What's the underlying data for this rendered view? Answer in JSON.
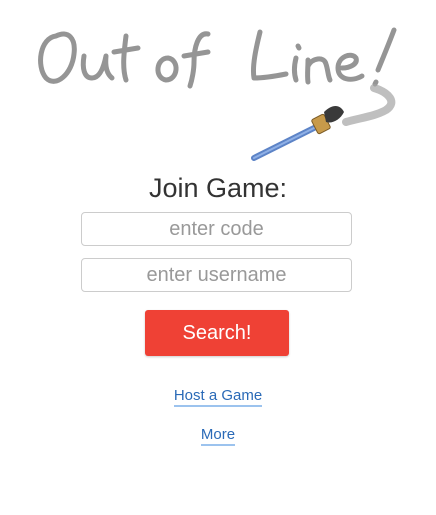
{
  "logo": {
    "text": "Out of Line!",
    "icon": "paintbrush-icon",
    "stroke_color": "#8a8a8a",
    "brush_handle_color": "#5d84c7"
  },
  "join": {
    "title": "Join Game:",
    "code_placeholder": "enter code",
    "username_placeholder": "enter username",
    "search_label": "Search!",
    "search_color": "#ef4135"
  },
  "links": {
    "host_label": "Host a Game",
    "more_label": "More",
    "color": "#2a6ab7"
  }
}
